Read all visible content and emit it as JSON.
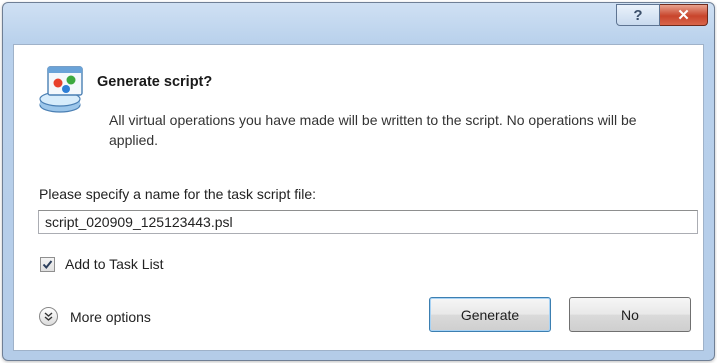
{
  "window": {
    "help_label": "?",
    "close_label": "✕"
  },
  "dialog": {
    "icon": "script-disk-icon",
    "heading": "Generate script?",
    "description": "All virtual operations you have made will be written to the script. No operations will be applied.",
    "prompt": "Please specify a name for the task script file:",
    "filename_value": "script_020909_125123443.psl",
    "add_to_task_list_label": "Add to Task List",
    "add_to_task_list_checked": true,
    "more_options_label": "More options",
    "generate_label": "Generate",
    "no_label": "No"
  }
}
